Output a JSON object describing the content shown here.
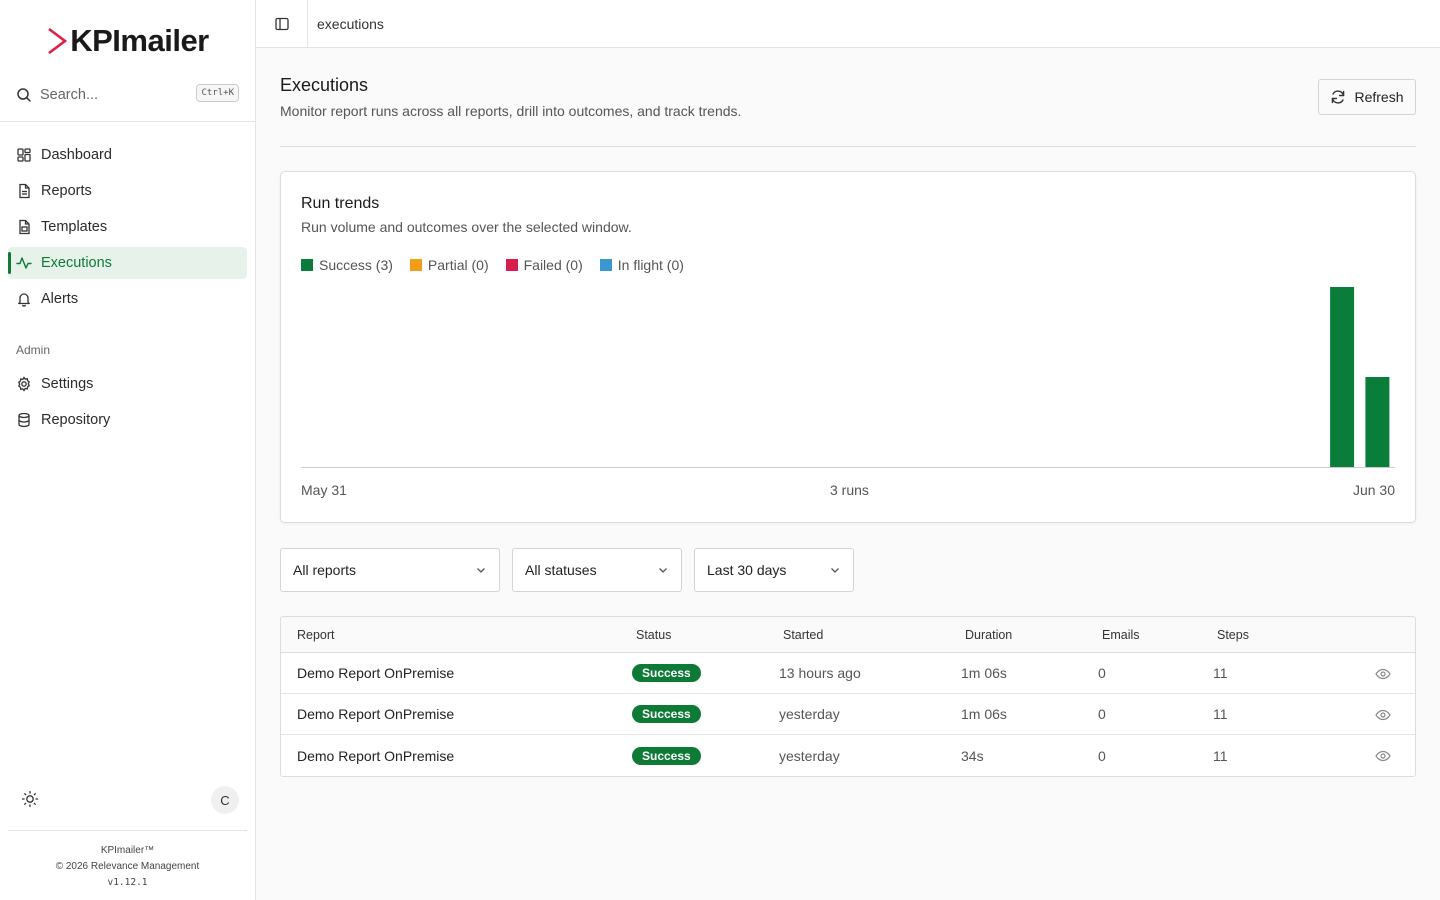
{
  "brand": {
    "name": "KPImailer",
    "accent": "#e11d48"
  },
  "search": {
    "placeholder": "Search...",
    "shortcut": "Ctrl+K"
  },
  "nav": {
    "items": [
      {
        "label": "Dashboard",
        "icon": "dashboard-icon"
      },
      {
        "label": "Reports",
        "icon": "file-icon"
      },
      {
        "label": "Templates",
        "icon": "template-icon"
      },
      {
        "label": "Executions",
        "icon": "activity-icon",
        "active": true
      },
      {
        "label": "Alerts",
        "icon": "bell-icon"
      }
    ],
    "admin_label": "Admin",
    "admin_items": [
      {
        "label": "Settings",
        "icon": "gear-icon"
      },
      {
        "label": "Repository",
        "icon": "database-icon"
      }
    ]
  },
  "user": {
    "initial": "C"
  },
  "footer": {
    "product": "KPImailer™",
    "copyright": "© 2026 Relevance Management",
    "version": "v1.12.1"
  },
  "topbar": {
    "breadcrumb": "executions"
  },
  "page": {
    "title": "Executions",
    "subtitle": "Monitor report runs across all reports, drill into outcomes, and track trends.",
    "refresh_label": "Refresh"
  },
  "trends": {
    "title": "Run trends",
    "subtitle": "Run volume and outcomes over the selected window.",
    "legend": [
      {
        "label": "Success (3)",
        "color": "#0a7d3a"
      },
      {
        "label": "Partial (0)",
        "color": "#f29d13"
      },
      {
        "label": "Failed (0)",
        "color": "#d61f4d"
      },
      {
        "label": "In flight (0)",
        "color": "#3a97cf"
      }
    ],
    "x_start": "May 31",
    "x_mid": "3 runs",
    "x_end": "Jun 30"
  },
  "chart_data": {
    "type": "bar",
    "title": "Run trends",
    "days": 31,
    "ymax": 2,
    "series": [
      {
        "name": "Success",
        "color": "#0a7d3a",
        "values": [
          0,
          0,
          0,
          0,
          0,
          0,
          0,
          0,
          0,
          0,
          0,
          0,
          0,
          0,
          0,
          0,
          0,
          0,
          0,
          0,
          0,
          0,
          0,
          0,
          0,
          0,
          0,
          0,
          0,
          2,
          1
        ]
      },
      {
        "name": "Partial",
        "color": "#f29d13",
        "values": [
          0,
          0,
          0,
          0,
          0,
          0,
          0,
          0,
          0,
          0,
          0,
          0,
          0,
          0,
          0,
          0,
          0,
          0,
          0,
          0,
          0,
          0,
          0,
          0,
          0,
          0,
          0,
          0,
          0,
          0,
          0
        ]
      },
      {
        "name": "Failed",
        "color": "#d61f4d",
        "values": [
          0,
          0,
          0,
          0,
          0,
          0,
          0,
          0,
          0,
          0,
          0,
          0,
          0,
          0,
          0,
          0,
          0,
          0,
          0,
          0,
          0,
          0,
          0,
          0,
          0,
          0,
          0,
          0,
          0,
          0,
          0
        ]
      },
      {
        "name": "In flight",
        "color": "#3a97cf",
        "values": [
          0,
          0,
          0,
          0,
          0,
          0,
          0,
          0,
          0,
          0,
          0,
          0,
          0,
          0,
          0,
          0,
          0,
          0,
          0,
          0,
          0,
          0,
          0,
          0,
          0,
          0,
          0,
          0,
          0,
          0,
          0
        ]
      }
    ]
  },
  "filters": {
    "report": "All reports",
    "status": "All statuses",
    "range": "Last 30 days"
  },
  "table": {
    "columns": [
      "Report",
      "Status",
      "Started",
      "Duration",
      "Emails",
      "Steps"
    ],
    "rows": [
      {
        "report": "Demo Report OnPremise",
        "status": "Success",
        "started": "13 hours ago",
        "duration": "1m 06s",
        "emails": "0",
        "steps": "11"
      },
      {
        "report": "Demo Report OnPremise",
        "status": "Success",
        "started": "yesterday",
        "duration": "1m 06s",
        "emails": "0",
        "steps": "11"
      },
      {
        "report": "Demo Report OnPremise",
        "status": "Success",
        "started": "yesterday",
        "duration": "34s",
        "emails": "0",
        "steps": "11"
      }
    ]
  }
}
